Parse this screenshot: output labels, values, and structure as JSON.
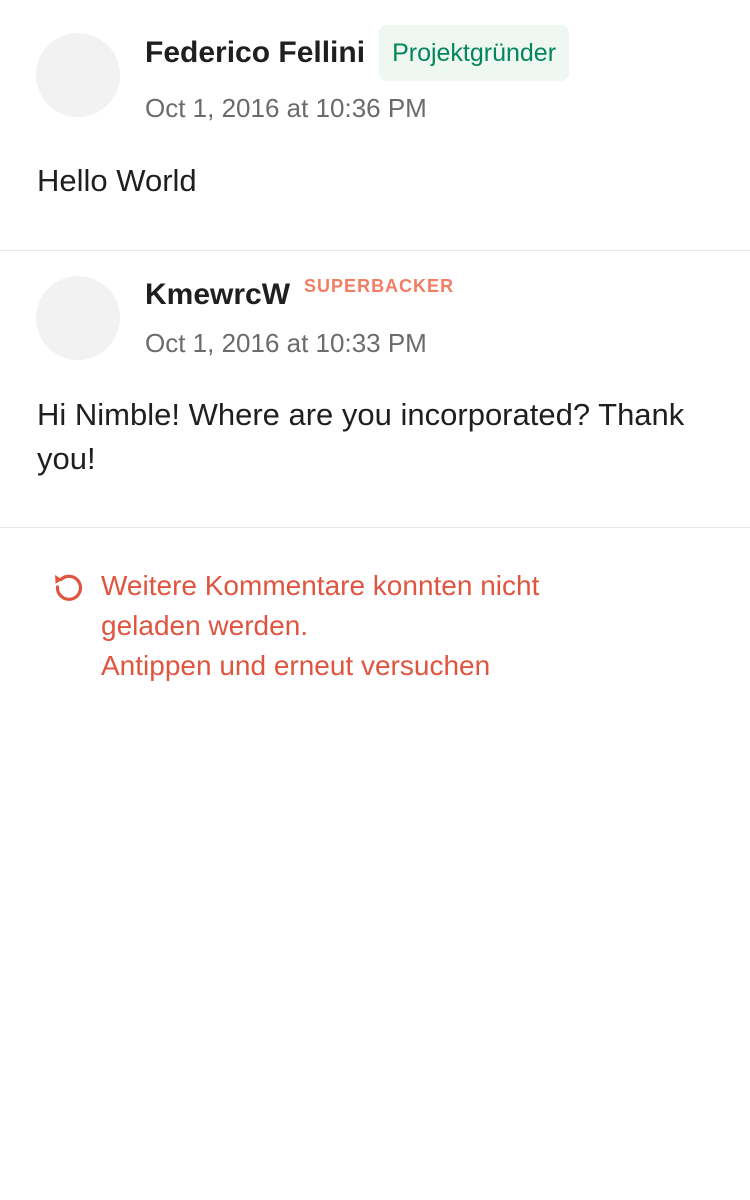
{
  "comments": [
    {
      "author": "Federico Fellini",
      "badge": "Projektgründer",
      "timestamp": "Oct 1, 2016 at 10:36 PM",
      "body": "Hello World"
    },
    {
      "author": "KmewrcW",
      "badge": "SUPERBACKER",
      "timestamp": "Oct 1, 2016 at 10:33 PM",
      "body": "Hi Nimble! Where are you incorporated? Thank you!"
    }
  ],
  "error": {
    "line1": "Weitere Kommentare konnten nicht",
    "line2": "geladen werden.",
    "line3": "Antippen und erneut versuchen",
    "icon": "retry-icon"
  },
  "colors": {
    "creator_badge_text": "#05865a",
    "creator_badge_bg": "#eef7f2",
    "superbacker": "#f37d63",
    "error": "#e0553f"
  }
}
